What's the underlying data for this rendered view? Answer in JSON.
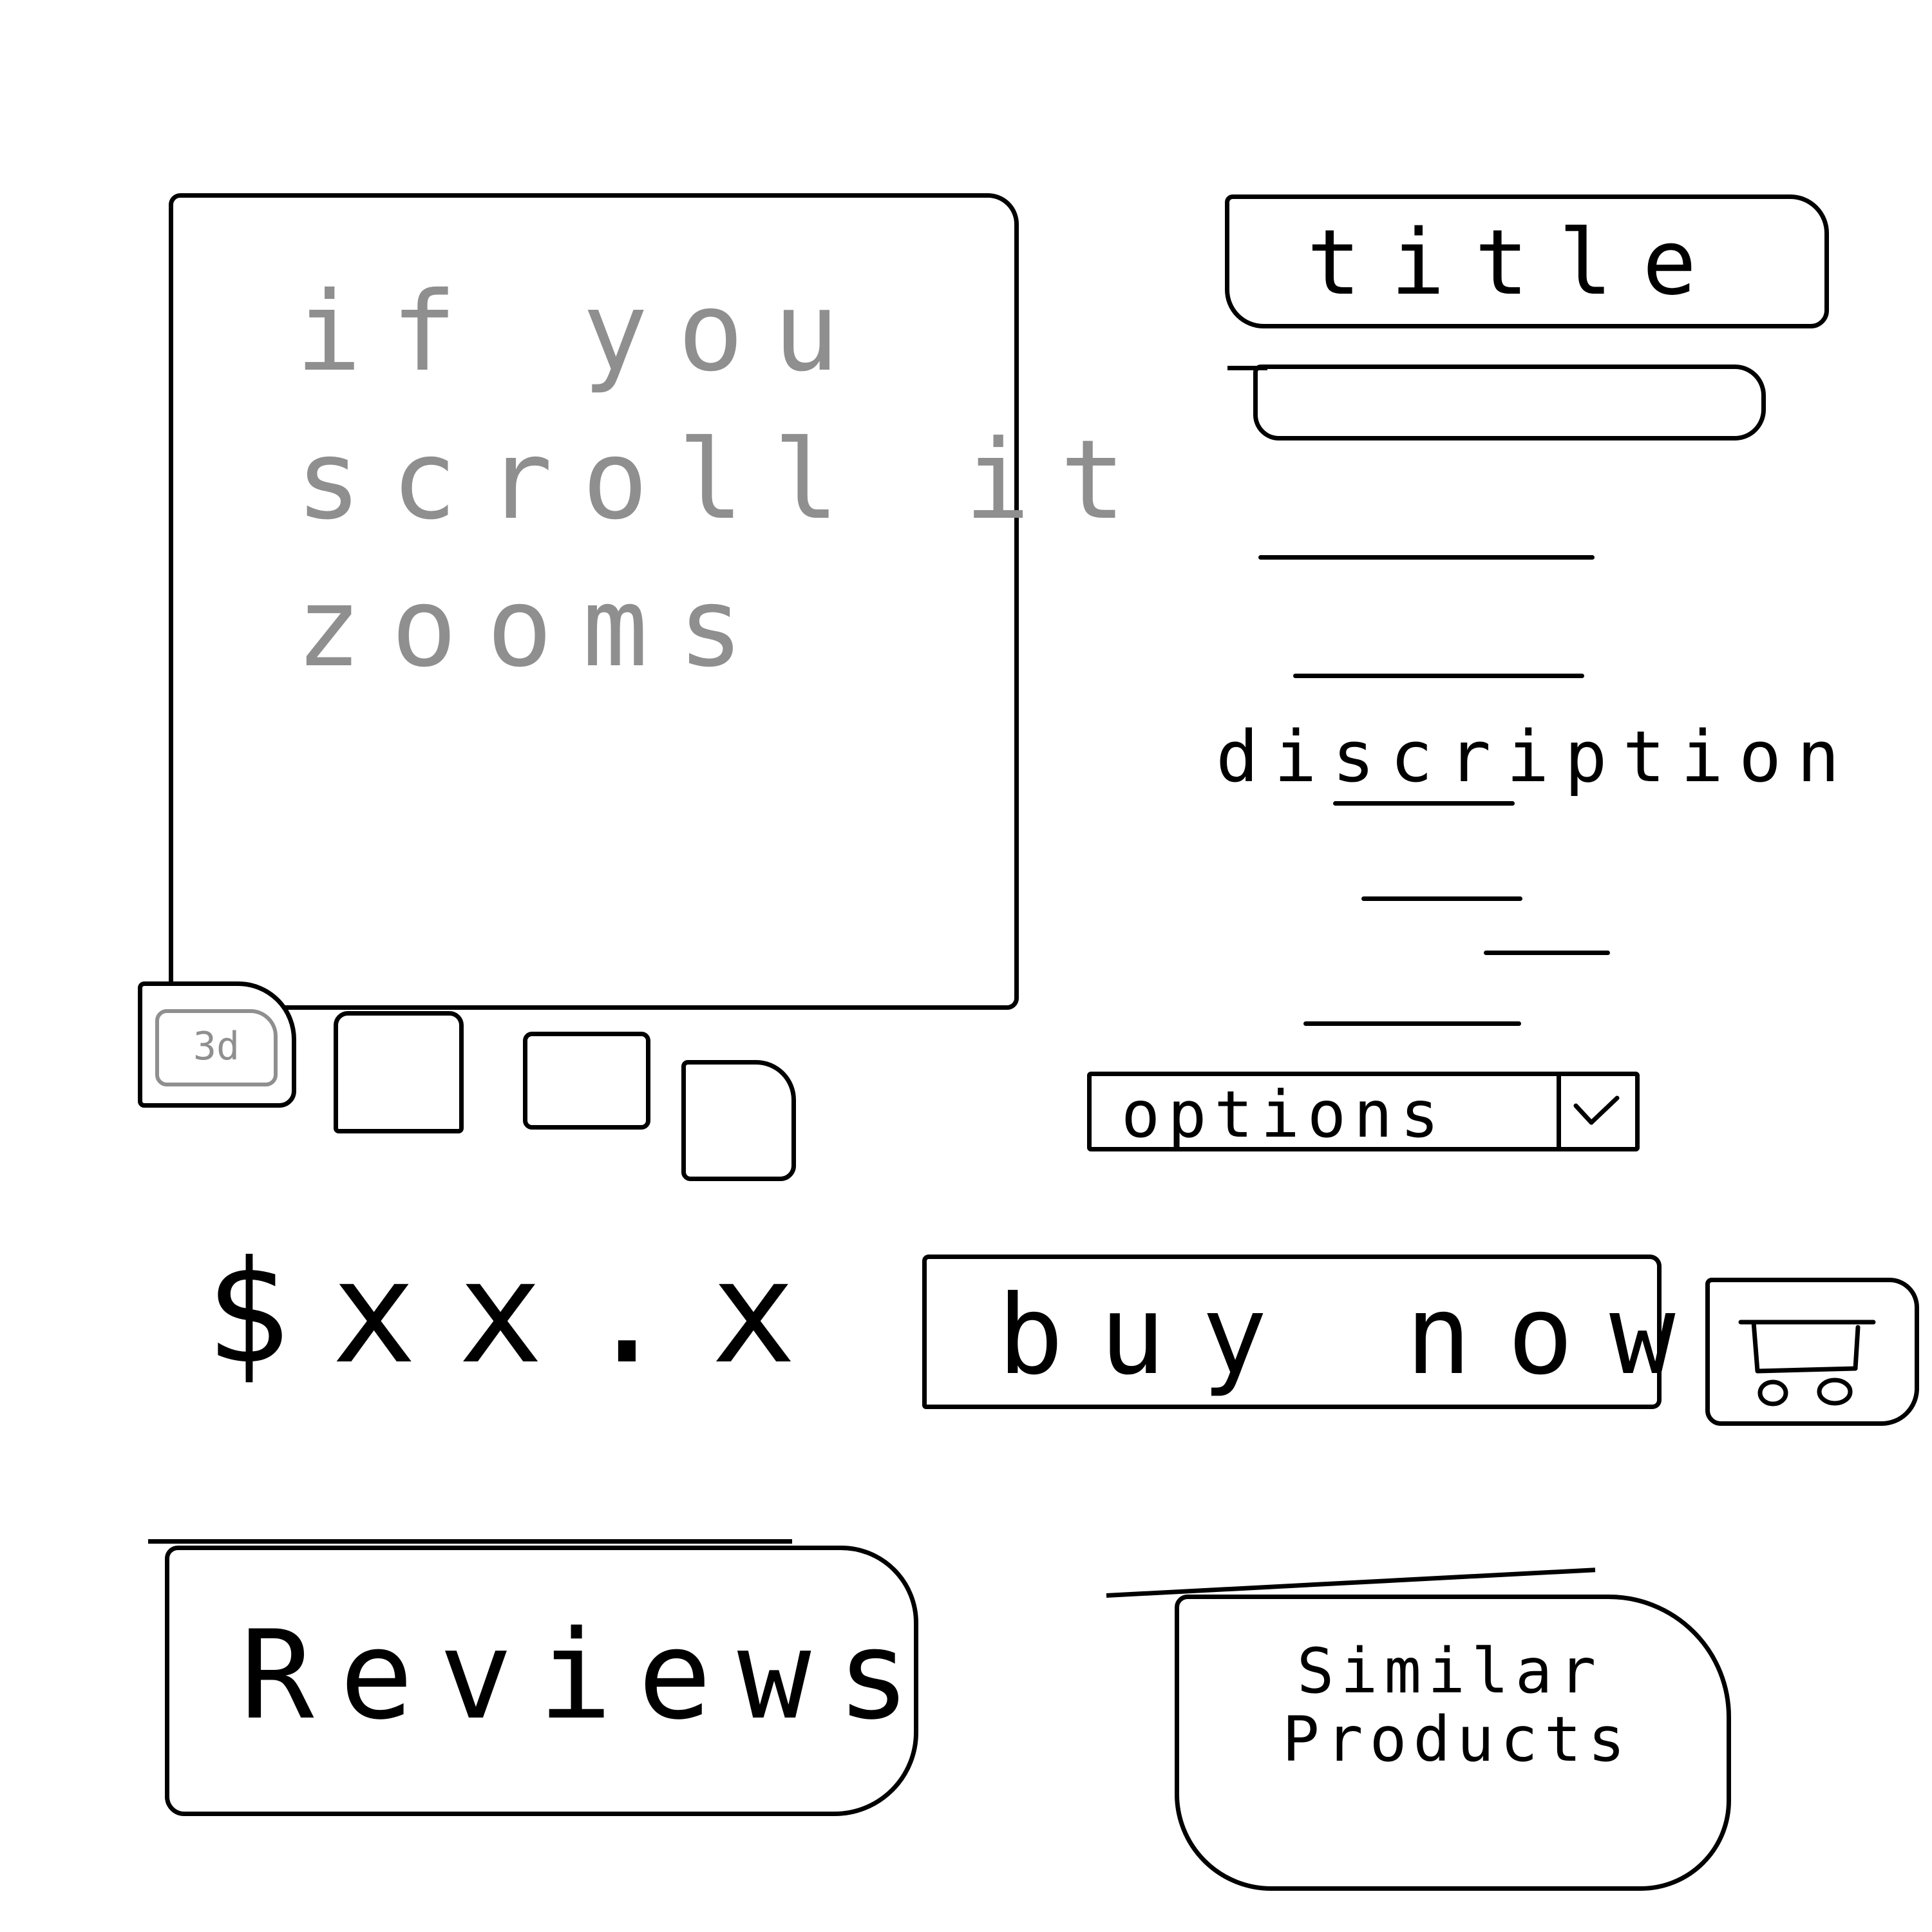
{
  "product_image": {
    "hint": "if you\nscroll it\nzooms"
  },
  "thumbnails": {
    "first_label": "3d"
  },
  "title": {
    "label": "title"
  },
  "description": {
    "label": "discription"
  },
  "options": {
    "label": "options",
    "icon": "chevron-down-icon"
  },
  "price": {
    "text": "$xx.x"
  },
  "buy": {
    "label": "buy now"
  },
  "cart": {
    "icon": "cart-icon"
  },
  "reviews": {
    "label": "Reviews"
  },
  "similar": {
    "label": "Similar\nProducts"
  }
}
